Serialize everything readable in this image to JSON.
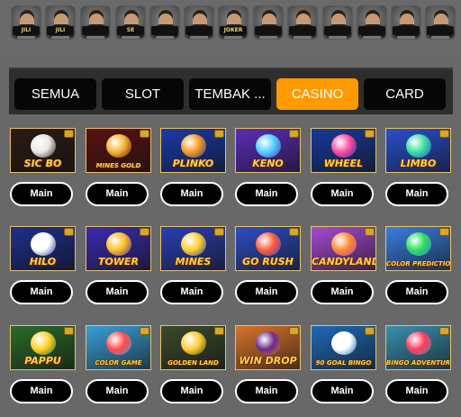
{
  "providers": [
    {
      "name": "JILI",
      "icon": "jili-logo"
    },
    {
      "name": "JILI",
      "icon": "jili-logo"
    },
    {
      "name": "",
      "icon": "provider-logo"
    },
    {
      "name": "SE",
      "icon": "se-logo"
    },
    {
      "name": "",
      "icon": "provider-logo"
    },
    {
      "name": "",
      "icon": "provider-logo"
    },
    {
      "name": "JOKER",
      "icon": "joker-logo"
    },
    {
      "name": "",
      "icon": "provider-logo"
    },
    {
      "name": "",
      "icon": "provider-logo"
    },
    {
      "name": "",
      "icon": "provider-logo"
    },
    {
      "name": "",
      "icon": "provider-logo"
    },
    {
      "name": "",
      "icon": "provider-logo"
    },
    {
      "name": "",
      "icon": "provider-logo"
    }
  ],
  "tabs": [
    {
      "label": "SEMUA"
    },
    {
      "label": "SLOT"
    },
    {
      "label": "TEMBAK ..."
    },
    {
      "label": "CASINO"
    },
    {
      "label": "CARD"
    }
  ],
  "active_tab": "CASINO",
  "colors": {
    "accent": "#ff9a00",
    "tab_bg": "#060606",
    "page_bg": "#686868"
  },
  "games": [
    {
      "title": "SIC BO",
      "button": "Main",
      "bg": "#2c1a12",
      "accent": "#e6e6e6"
    },
    {
      "title": "MINES GOLD",
      "button": "Main",
      "bg": "#5a1212",
      "accent": "#f2b632"
    },
    {
      "title": "PLINKO",
      "button": "Main",
      "bg": "#1b3aa8",
      "accent": "#f79a1f"
    },
    {
      "title": "KENO",
      "button": "Main",
      "bg": "#5b2db8",
      "accent": "#4fd0ff"
    },
    {
      "title": "WHEEL",
      "button": "Main",
      "bg": "#173a9a",
      "accent": "#ff4aa0"
    },
    {
      "title": "LIMBO",
      "button": "Main",
      "bg": "#2a4fd1",
      "accent": "#3ae0a0"
    },
    {
      "title": "HILO",
      "button": "Main",
      "bg": "#1e2f8f",
      "accent": "#ffffff"
    },
    {
      "title": "TOWER",
      "button": "Main",
      "bg": "#3b2bb0",
      "accent": "#ffbf1f"
    },
    {
      "title": "MINES",
      "button": "Main",
      "bg": "#2a3fb3",
      "accent": "#ffcf2a"
    },
    {
      "title": "GO RUSH",
      "button": "Main",
      "bg": "#2c4ec4",
      "accent": "#ff5a3a"
    },
    {
      "title": "CANDYLAND",
      "button": "Main",
      "bg": "#a64ad0",
      "accent": "#ff8a2a"
    },
    {
      "title": "COLOR PREDICTION",
      "button": "Main",
      "bg": "#3a7de0",
      "accent": "#2adf5a"
    },
    {
      "title": "PAPPU",
      "button": "Main",
      "bg": "#2b6a2b",
      "accent": "#ffd22a"
    },
    {
      "title": "COLOR GAME",
      "button": "Main",
      "bg": "#3a9fd8",
      "accent": "#ff4a4a"
    },
    {
      "title": "GOLDEN LAND",
      "button": "Main",
      "bg": "#3b4a2a",
      "accent": "#ffcc33"
    },
    {
      "title": "WIN DROP",
      "button": "Main",
      "bg": "#d8742a",
      "accent": "#6a2a8a"
    },
    {
      "title": "90 GOAL BINGO",
      "button": "Main",
      "bg": "#1f6ab8",
      "accent": "#ffffff"
    },
    {
      "title": "BINGO ADVENTURE",
      "button": "Main",
      "bg": "#3a8fae",
      "accent": "#ff3a5a"
    }
  ]
}
